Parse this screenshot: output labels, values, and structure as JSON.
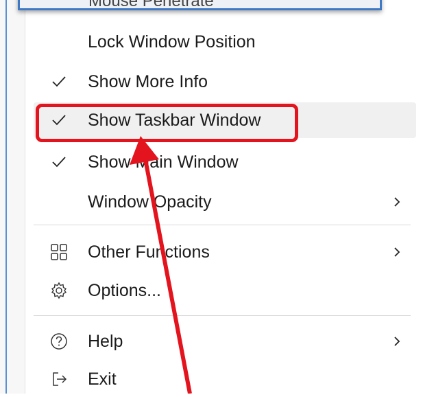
{
  "window": {
    "partial_title": "Mouse Penetrate"
  },
  "menu": {
    "items": [
      {
        "label": "Lock Window Position",
        "checked": false,
        "icon": "none",
        "submenu": false
      },
      {
        "label": "Show More Info",
        "checked": true,
        "icon": "checkmark-icon",
        "submenu": false
      },
      {
        "label": "Show Taskbar Window",
        "checked": true,
        "icon": "checkmark-icon",
        "submenu": false,
        "highlighted": true
      },
      {
        "label": "Show Main Window",
        "checked": true,
        "icon": "checkmark-icon",
        "submenu": false
      },
      {
        "label": "Window Opacity",
        "checked": false,
        "icon": "none",
        "submenu": true
      },
      {
        "label": "Other Functions",
        "checked": false,
        "icon": "grid-icon",
        "submenu": true
      },
      {
        "label": "Options...",
        "checked": false,
        "icon": "gear-icon",
        "submenu": false
      },
      {
        "label": "Help",
        "checked": false,
        "icon": "help-icon",
        "submenu": true
      },
      {
        "label": "Exit",
        "checked": false,
        "icon": "exit-icon",
        "submenu": false
      }
    ]
  },
  "annotation": {
    "color": "#e3141d",
    "target": "Show Taskbar Window"
  }
}
